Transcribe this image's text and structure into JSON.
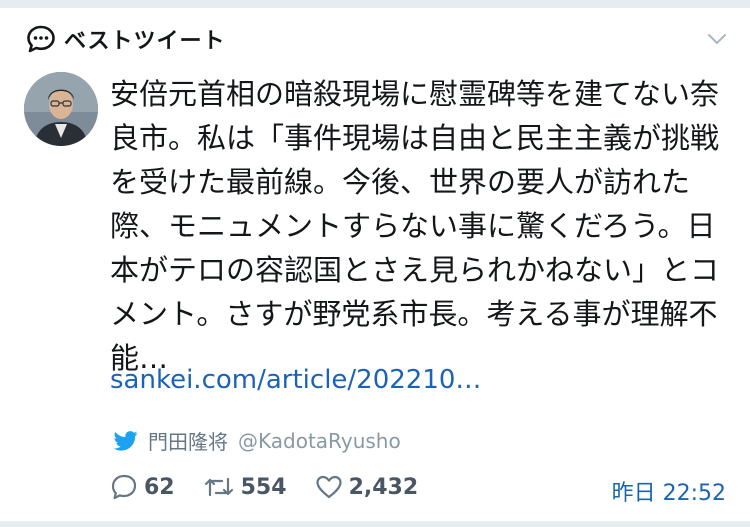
{
  "header": {
    "title": "ベストツイート"
  },
  "tweet": {
    "text": "安倍元首相の暗殺現場に慰霊碑等を建てない奈良市。私は「事件現場は自由と民主主義が挑戦を受けた最前線。今後、世界の要人が訪れた際、モニュメントすらない事に驚くだろう。日本がテロの容認国とさえ見られかねない」とコメント。さすが野党系市長。考える事が理解不能…",
    "link": "sankei.com/article/202210…"
  },
  "author": {
    "name": "門田隆将",
    "handle": "@KadotaRyusho"
  },
  "stats": {
    "replies": "62",
    "retweets": "554",
    "likes": "2,432"
  },
  "timestamp": "昨日 22:52",
  "colors": {
    "link": "#1b64b5",
    "muted": "#8899a6",
    "twitter_blue": "#1da1f2"
  },
  "icons": [
    "speech-bubble-icon",
    "chevron-down-icon",
    "twitter-bird-icon",
    "reply-icon",
    "retweet-icon",
    "like-icon"
  ]
}
